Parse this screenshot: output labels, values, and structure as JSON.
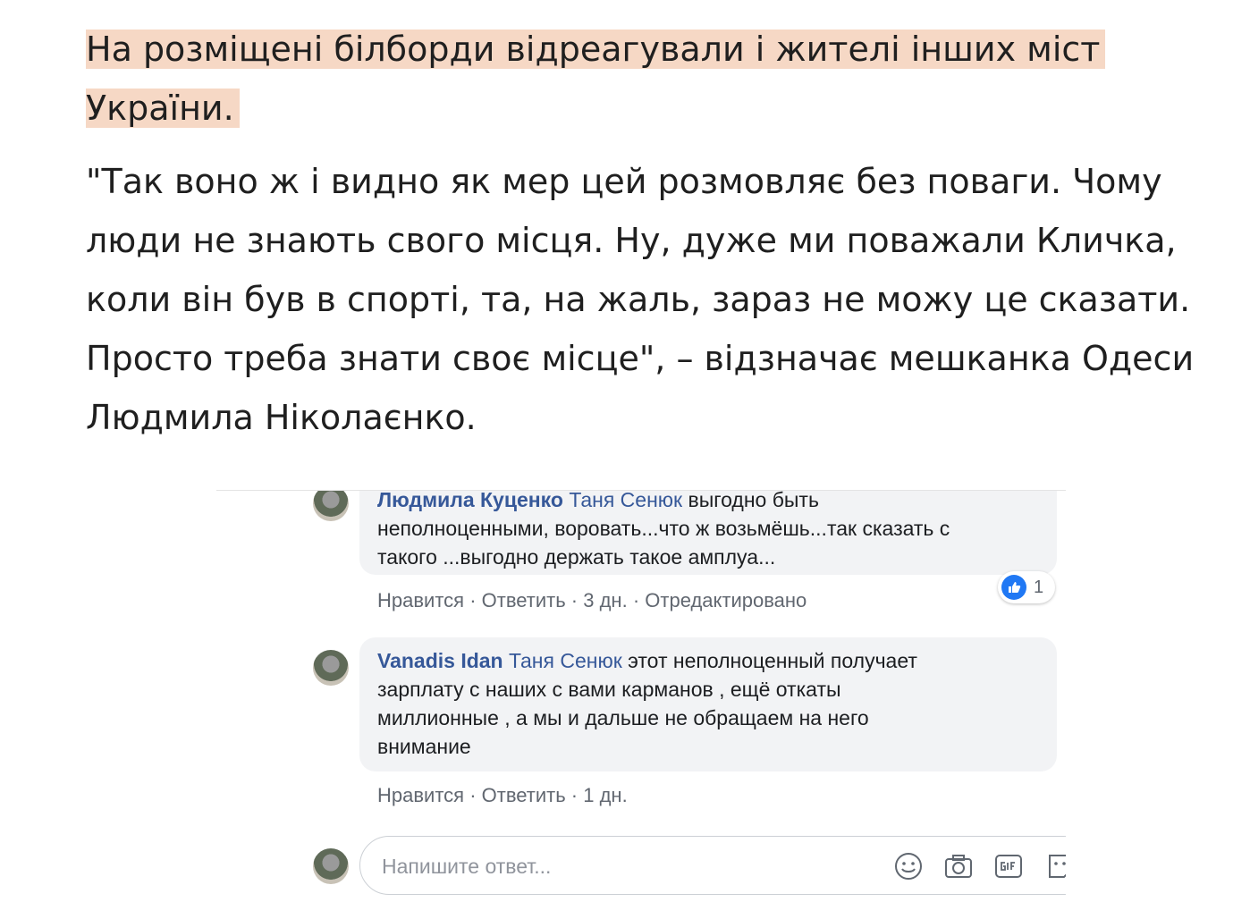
{
  "article": {
    "highlight_text": "На розміщені білборди відреагували і жителі інших міст України.",
    "quote_text": "\"Так воно ж і видно як мер цей розмовляє без поваги. Чому люди не знають свого місця. Ну, дуже ми поважали Кличка, коли він був в спорті, та, на жаль, зараз не можу це сказати. Просто треба знати своє місце\", – відзначає мешканка Одеси Людмила Ніколаєнко."
  },
  "comments": [
    {
      "author": "Людмила Куценко",
      "mention": "Таня Сенюк",
      "text_lines": [
        " выгодно быть",
        "неполноценными, воровать...что ж возьмёшь...так сказать с",
        "такого ...выгодно держать такое амплуа..."
      ],
      "like": "Нравится",
      "reply": "Ответить",
      "time": "3 дн.",
      "edited": "Отредактировано",
      "reaction_count": "1"
    },
    {
      "author": "Vanadis Idan",
      "mention": "Таня Сенюк",
      "text_lines": [
        " этот неполноценный получает",
        "зарплату с наших с вами карманов , ещё откаты",
        "миллионные , а мы и дальше не обращаем на него",
        "внимание"
      ],
      "like": "Нравится",
      "reply": "Ответить",
      "time": "1 дн."
    }
  ],
  "reply_box": {
    "placeholder": "Напишите ответ...",
    "icons": [
      "emoji-icon",
      "camera-icon",
      "gif-icon",
      "sticker-icon"
    ]
  },
  "colors": {
    "highlight": "#f6d8c5",
    "link": "#365899",
    "like_blue": "#2078f4"
  }
}
